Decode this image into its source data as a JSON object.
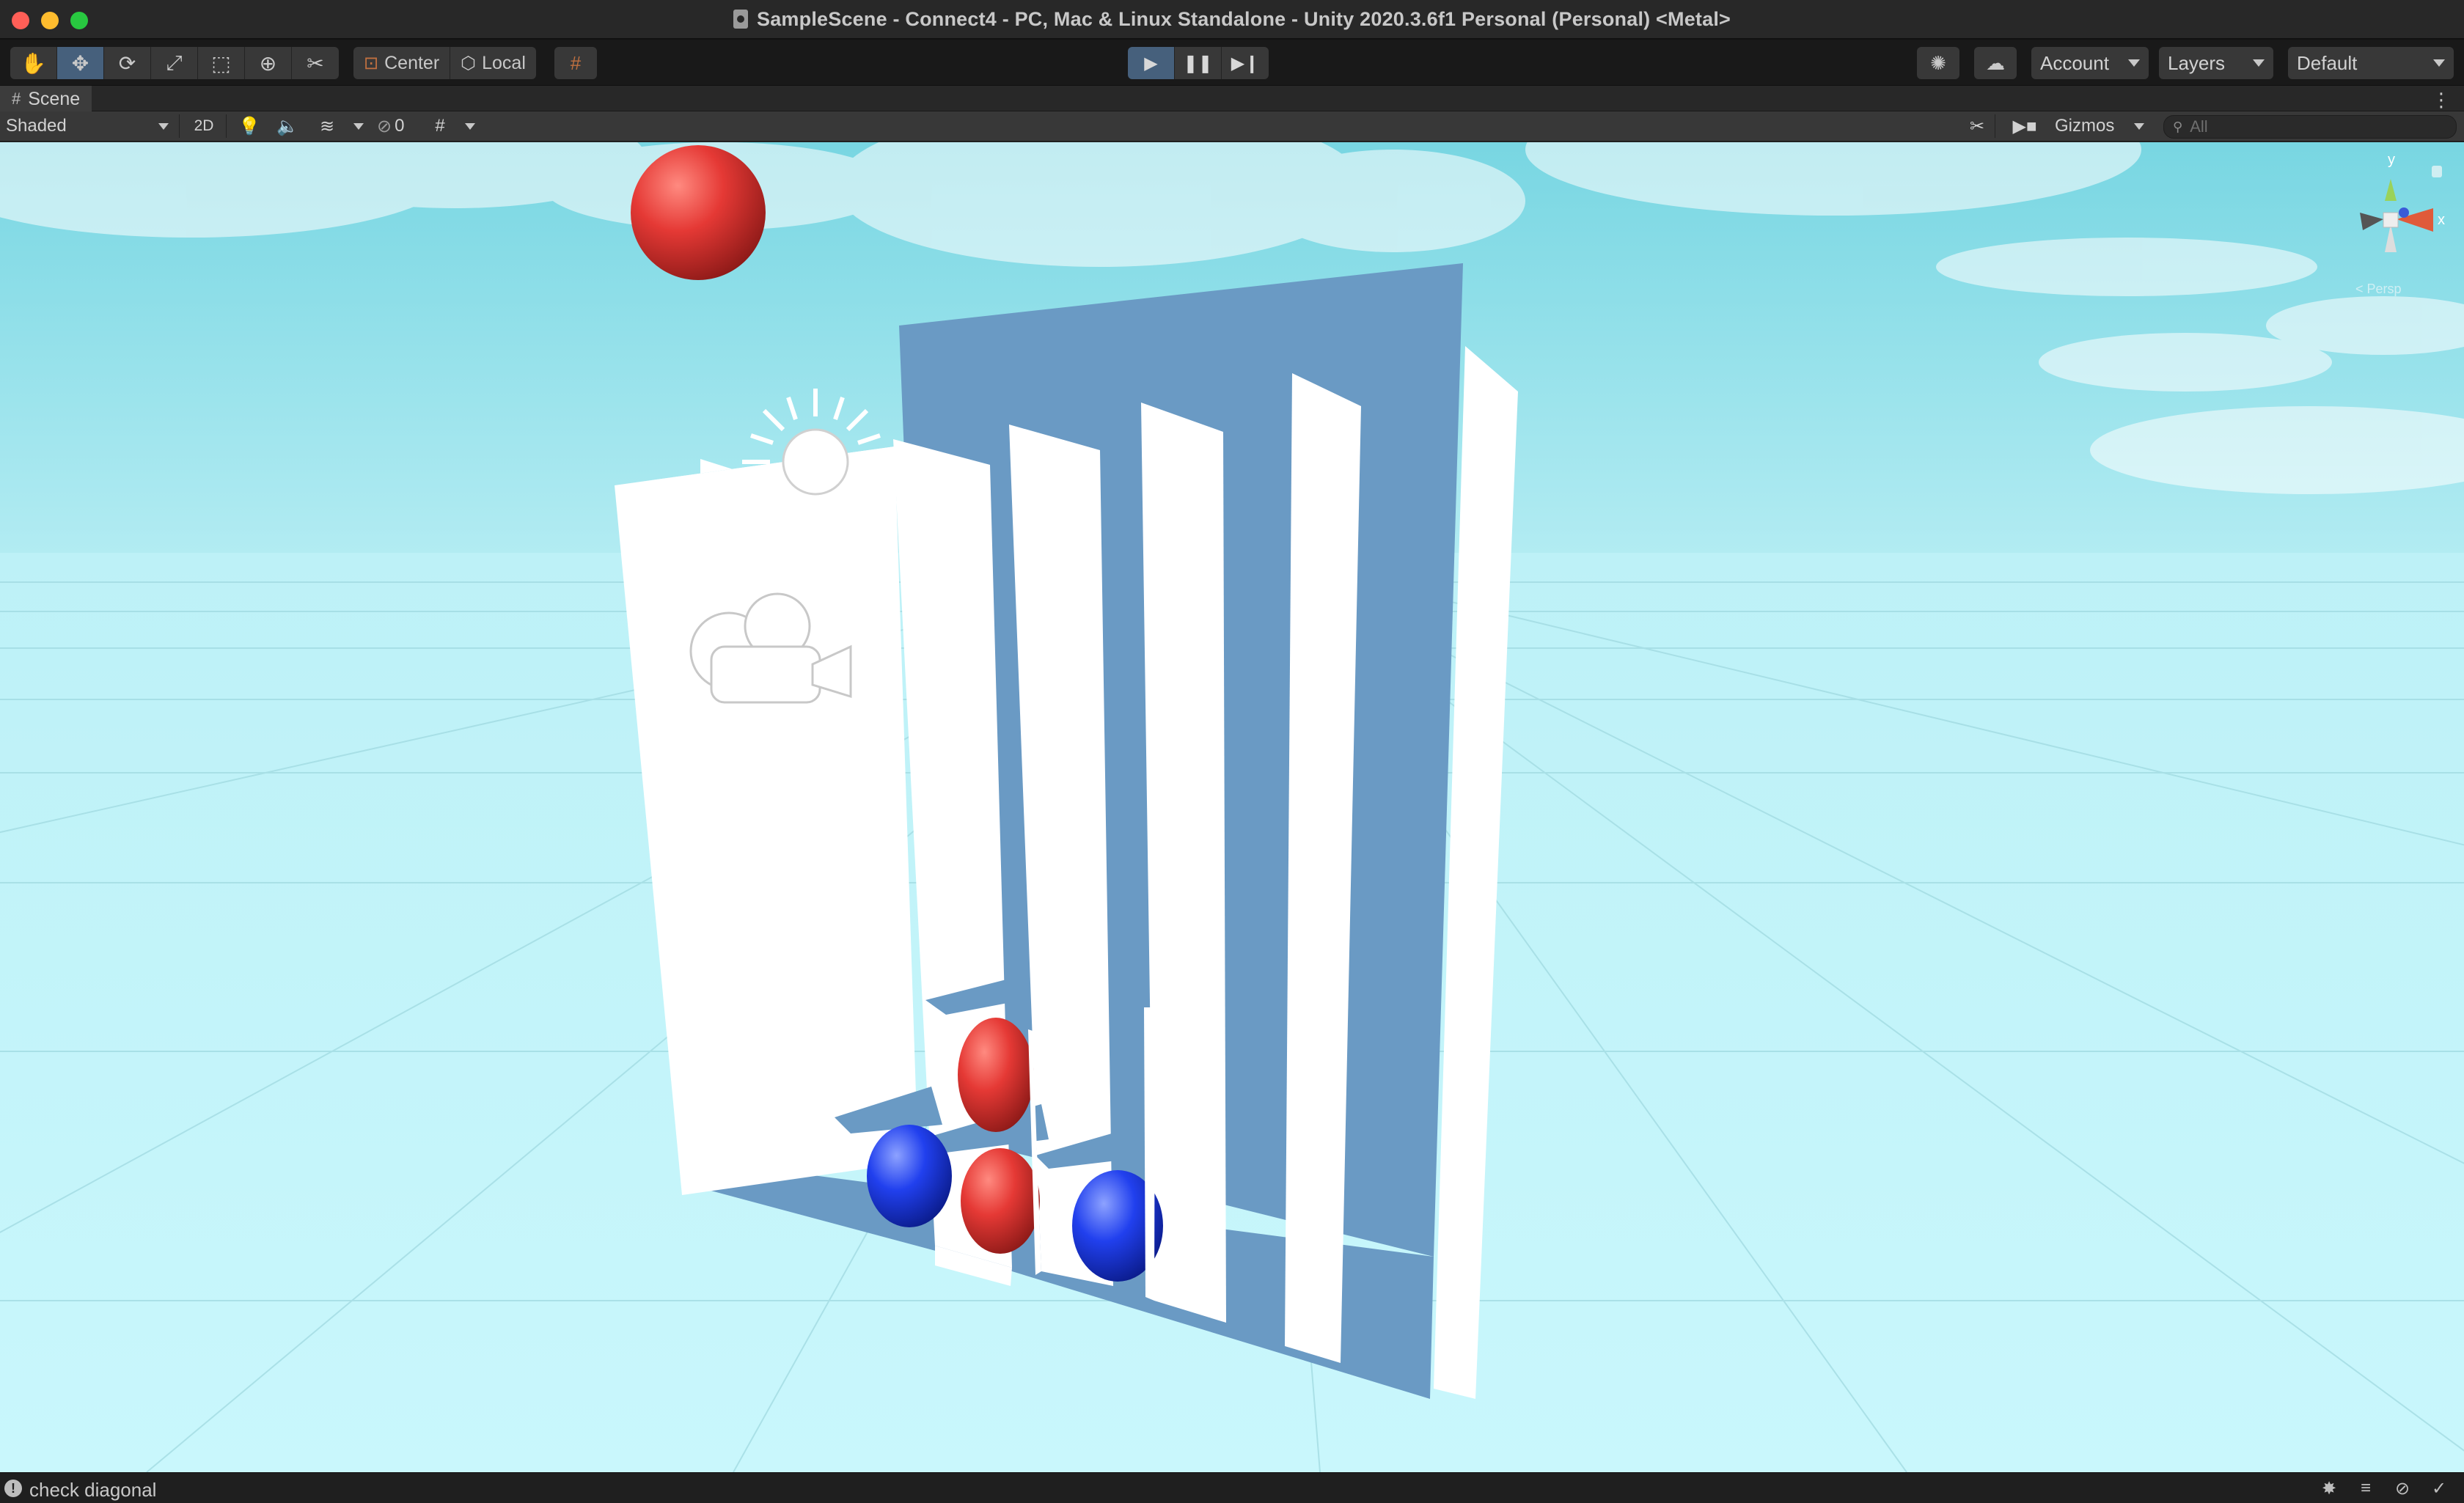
{
  "window": {
    "title": "SampleScene - Connect4 - PC, Mac & Linux Standalone - Unity 2020.3.6f1 Personal (Personal) <Metal>"
  },
  "toolbar": {
    "tools": [
      {
        "name": "hand-tool-icon",
        "glyph": "✋"
      },
      {
        "name": "move-tool-icon",
        "glyph": "✥",
        "active": true
      },
      {
        "name": "rotate-tool-icon",
        "glyph": "⟳"
      },
      {
        "name": "scale-tool-icon",
        "glyph": "⤢"
      },
      {
        "name": "rect-tool-icon",
        "glyph": "⬚"
      },
      {
        "name": "transform-tool-icon",
        "glyph": "⊕"
      },
      {
        "name": "custom-tool-icon",
        "glyph": "✂"
      }
    ],
    "pivot_label": "Center",
    "space_label": "Local",
    "account_label": "Account",
    "layers_label": "Layers",
    "layout_label": "Default"
  },
  "scene_tab": {
    "label": "Scene"
  },
  "scene_toolbar": {
    "draw_mode": "Shaded",
    "mode_2d": "2D",
    "hidden_count": "0",
    "gizmos_label": "Gizmos",
    "search_placeholder": "All"
  },
  "viewport": {
    "sky_color": "#9fe3ee",
    "ground_color": "#c9f6fb",
    "board_blue": "#6a9ac4",
    "red_piece": "#e53935",
    "blue_piece": "#1e3de0"
  },
  "status": {
    "message": "check diagonal"
  }
}
